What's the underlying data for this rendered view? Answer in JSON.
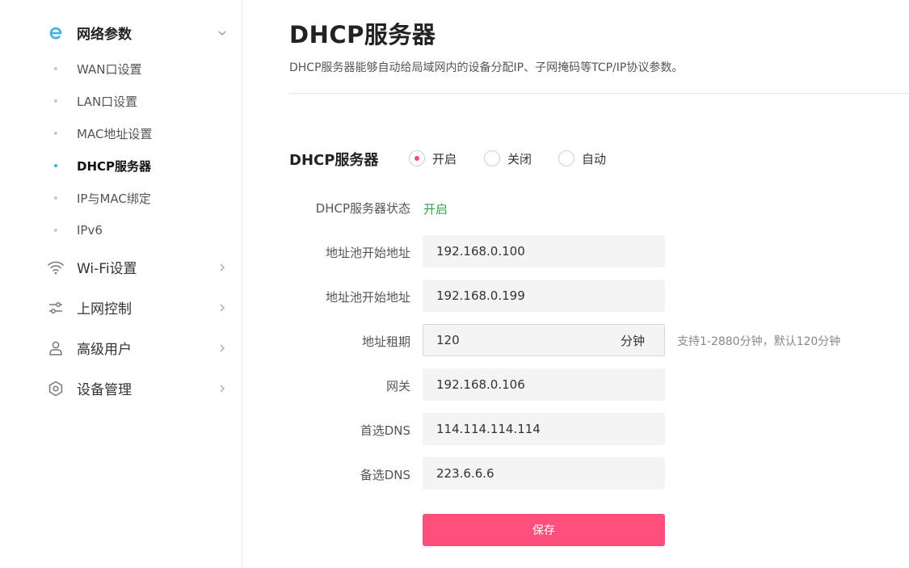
{
  "sidebar": {
    "groups": [
      {
        "label": "网络参数",
        "icon": "e-logo-icon",
        "expanded": true
      },
      {
        "label": "Wi-Fi设置",
        "icon": "wifi-icon"
      },
      {
        "label": "上网控制",
        "icon": "sliders-icon"
      },
      {
        "label": "高级用户",
        "icon": "user-icon"
      },
      {
        "label": "设备管理",
        "icon": "gear-icon"
      }
    ],
    "sub_items": [
      {
        "label": "WAN口设置"
      },
      {
        "label": "LAN口设置"
      },
      {
        "label": "MAC地址设置"
      },
      {
        "label": "DHCP服务器",
        "active": true
      },
      {
        "label": "IP与MAC绑定"
      },
      {
        "label": "IPv6"
      }
    ]
  },
  "main": {
    "title": "DHCP服务器",
    "description": "DHCP服务器能够自动给局域网内的设备分配IP、子网掩码等TCP/IP协议参数。",
    "mode": {
      "label": "DHCP服务器",
      "options": [
        {
          "label": "开启",
          "checked": true
        },
        {
          "label": "关闭",
          "checked": false
        },
        {
          "label": "自动",
          "checked": false
        }
      ]
    },
    "status": {
      "label": "DHCP服务器状态",
      "value": "开启"
    },
    "fields": {
      "pool_start": {
        "label": "地址池开始地址",
        "value": "192.168.0.100"
      },
      "pool_end": {
        "label": "地址池开始地址",
        "value": "192.168.0.199"
      },
      "lease": {
        "label": "地址租期",
        "value": "120",
        "unit": "分钟",
        "hint": "支持1-2880分钟，默认120分钟"
      },
      "gateway": {
        "label": "网关",
        "value": "192.168.0.106"
      },
      "dns_primary": {
        "label": "首选DNS",
        "value": "114.114.114.114"
      },
      "dns_secondary": {
        "label": "备选DNS",
        "value": "223.6.6.6"
      }
    },
    "save_label": "保存"
  },
  "colors": {
    "accent": "#ff4f7a",
    "radio_dot": "#f24c76",
    "status_on": "#2ea44f",
    "active_dot": "#3cb1e6",
    "logo": "#3cb1e6"
  }
}
